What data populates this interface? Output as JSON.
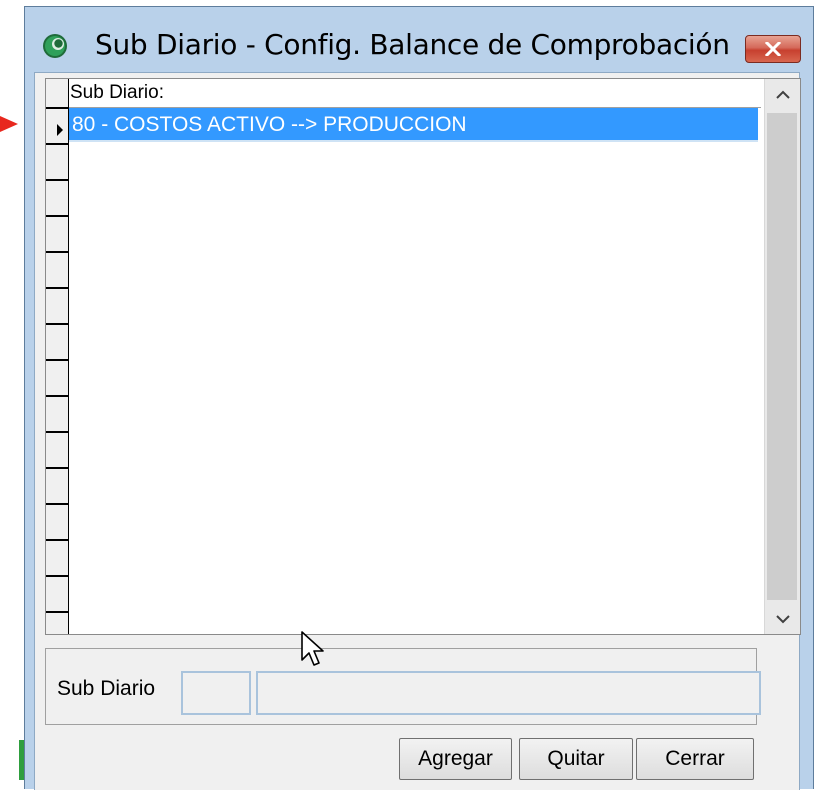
{
  "window": {
    "title": "Sub Diario - Config. Balance de Comprobación"
  },
  "grid": {
    "column_header": "Sub Diario:",
    "rows": [
      "80 - COSTOS  ACTIVO --> PRODUCCION"
    ],
    "selected_row": 0
  },
  "form": {
    "label": "Sub Diario",
    "code_value": "",
    "description_value": ""
  },
  "buttons": {
    "add": "Agregar",
    "remove": "Quitar",
    "close": "Cerrar"
  },
  "colors": {
    "selection": "#3399ff",
    "close_button": "#c7402f",
    "window_frame": "#b9d1ea"
  },
  "icons": [
    "app-icon",
    "close-icon",
    "scroll-up-icon",
    "scroll-down-icon",
    "row-pointer-icon",
    "mouse-cursor-icon"
  ]
}
